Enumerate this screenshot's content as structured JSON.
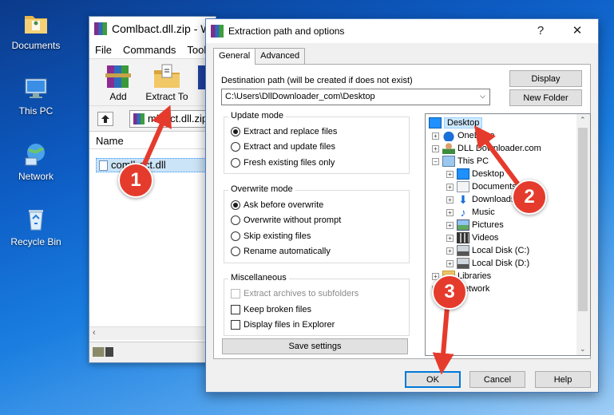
{
  "desktop": {
    "icons": [
      {
        "label": "Documents"
      },
      {
        "label": "This PC"
      },
      {
        "label": "Network"
      },
      {
        "label": "Recycle Bin"
      }
    ]
  },
  "winrar": {
    "title": "Comlbact.dll.zip - W",
    "menu": [
      "File",
      "Commands",
      "Tools"
    ],
    "toolbar": {
      "add": "Add",
      "extract_to": "Extract To"
    },
    "address": "mlbact.dll.zip",
    "list_header": "Name",
    "file": "comlbact.dll"
  },
  "dialog": {
    "title": "Extraction path and options",
    "help": "?",
    "close": "✕",
    "tabs": [
      "General",
      "Advanced"
    ],
    "dest_label": "Destination path (will be created if does not exist)",
    "dest_value": "C:\\Users\\DllDownloader_com\\Desktop",
    "buttons": {
      "display": "Display",
      "new_folder": "New Folder",
      "save_settings": "Save settings",
      "ok": "OK",
      "cancel": "Cancel",
      "help": "Help"
    },
    "update_mode": {
      "title": "Update mode",
      "options": [
        "Extract and replace files",
        "Extract and update files",
        "Fresh existing files only"
      ],
      "selected": 0
    },
    "overwrite_mode": {
      "title": "Overwrite mode",
      "options": [
        "Ask before overwrite",
        "Overwrite without prompt",
        "Skip existing files",
        "Rename automatically"
      ],
      "selected": 0
    },
    "misc": {
      "title": "Miscellaneous",
      "options": [
        "Extract archives to subfolders",
        "Keep broken files",
        "Display files in Explorer"
      ]
    },
    "tree": {
      "items": [
        "Desktop",
        "OneDrive",
        "DLL Downloader.com",
        "This PC",
        "Desktop",
        "Documents",
        "Downloads",
        "Music",
        "Pictures",
        "Videos",
        "Local Disk (C:)",
        "Local Disk (D:)",
        "Libraries",
        "Network"
      ],
      "selected": "Desktop"
    }
  },
  "callouts": [
    "1",
    "2",
    "3"
  ],
  "colors": {
    "callout": "#e53b2c",
    "selection": "#cce8ff",
    "accent": "#0078d7"
  }
}
